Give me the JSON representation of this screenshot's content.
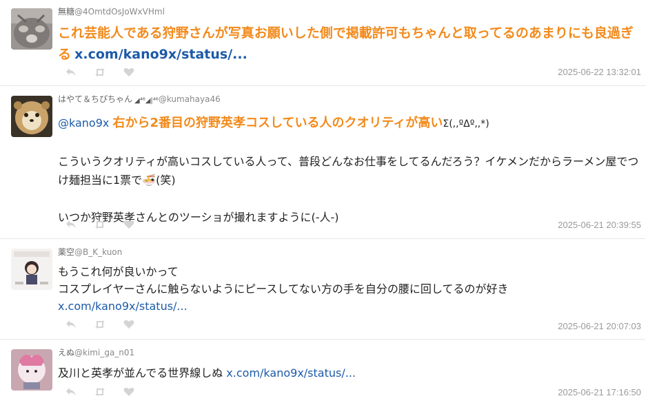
{
  "tweets": [
    {
      "name": "無糖",
      "handle": "@4OmtdOsJoWxVHml",
      "highlight": "これ芸能人である狩野さんが写真お願いした側で掲載許可もちゃんと取ってるのあまりにも良過ぎる",
      "link": "x.com/kano9x/status/...",
      "timestamp": "2025-06-22 13:32:01"
    },
    {
      "name": "はやて＆ちぴちゃん",
      "signal": "◢⁴⁶◢|⁴⁶",
      "handle": "@kumahaya46",
      "mention": "@kano9x",
      "highlight": "右から2番目の狩野英孝コスしている人のクオリティが高い",
      "suffix": "Σ(,,ºΔº,,*)",
      "para2": "こういうクオリティが高いコスしている人って、普段どんなお仕事をしてるんだろう？イケメンだからラーメン屋でつけ麺担当に1票で🍜(笑)",
      "para3": "いつか狩野英孝さんとのツーショが撮れますように(-人-)",
      "timestamp": "2025-06-21 20:39:55"
    },
    {
      "name": "薬空",
      "handle": "@B_K_kuon",
      "line1": "もうこれ何が良いかって",
      "line2": "コスプレイヤーさんに触らないようにピースしてない方の手を自分の腰に回してるのが好き",
      "link": "x.com/kano9x/status/...",
      "timestamp": "2025-06-21 20:07:03"
    },
    {
      "name": "えぬ",
      "handle": "@kimi_ga_n01",
      "text": "及川と英孝が並んでる世界線しぬ",
      "link": "x.com/kano9x/status/...",
      "timestamp": "2025-06-21 17:16:50"
    }
  ],
  "icons": {
    "reply": "reply-icon",
    "retweet": "retweet-icon",
    "like": "heart-icon"
  },
  "colors": {
    "highlight": "#f28a1b",
    "link": "#1c5aa8",
    "muted": "#9a9a9a",
    "icon": "#d4d4d4"
  }
}
